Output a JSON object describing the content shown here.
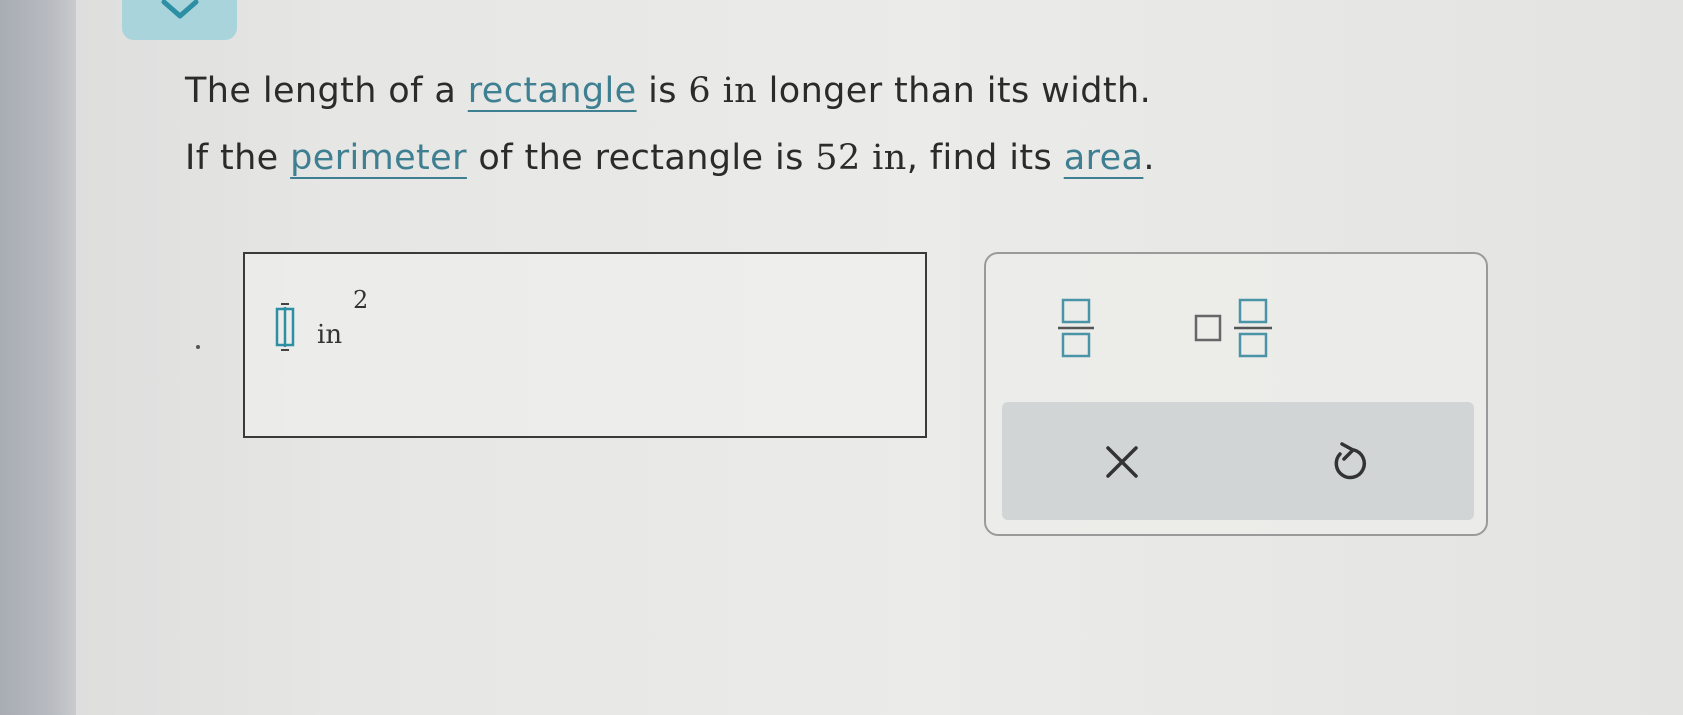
{
  "question": {
    "line1": {
      "p1": "The length of a ",
      "term1": "rectangle",
      "p2": " is ",
      "num1": "6 in",
      "p3": " longer than its width."
    },
    "line2": {
      "p1": "If the ",
      "term2": "perimeter",
      "p2": " of the rectangle is ",
      "num2": "52 in",
      "p3": ", find its ",
      "term3": "area",
      "p4": "."
    }
  },
  "answer": {
    "unit": "in",
    "unit_exponent": "2",
    "value": ""
  },
  "keypad": {
    "keys": [
      "fraction",
      "mixed-number"
    ],
    "actions": [
      "clear",
      "reset"
    ]
  },
  "colors": {
    "term": "#3f7f92",
    "accent": "#a9d4dc",
    "input_cursor": "#2d8fa3"
  }
}
